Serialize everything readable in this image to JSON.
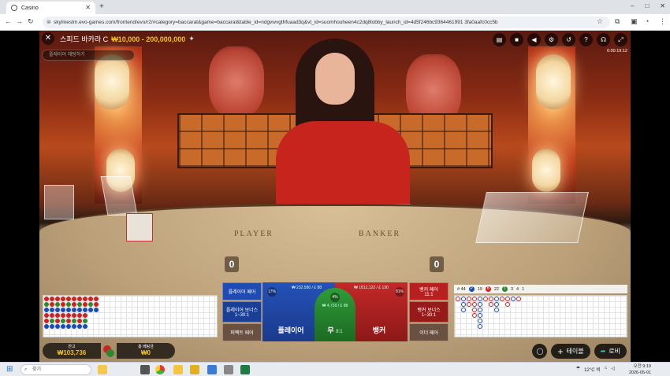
{
  "browser": {
    "tab_title": "Casino",
    "new_tab": "+",
    "url": "skylinestm.evo-games.com/frontend/evo/r2/#category=baccarat&game=baccarat&table_id=ndgvwvgthfuaad3q&vt_id=suomhouheen4c2dq8lobby_launch_id=4d5f246bc9364461991 3fa0aafc0cc5b",
    "window_controls": [
      "–",
      "□",
      "✕"
    ]
  },
  "game": {
    "title": "스피드 바카라 C",
    "limits": "₩10,000 - 200,000,000",
    "chat_placeholder": "플레이어 채팅하기",
    "timer": "0:00:19:12",
    "player_word": "PLAYER",
    "banker_word": "BANKER",
    "player_score": "0",
    "banker_score": "0",
    "colors": {
      "player": "#1a3a8c",
      "banker": "#a01c1c",
      "tie": "#237a2a",
      "gold": "#f3c21a"
    }
  },
  "bets": {
    "player_pair": "플레이어 페어",
    "player_bonus": "플레이어 보너스",
    "player_bonus_odds": "1~30:1",
    "perfect_pair": "퍼펙트 페어",
    "player_main": "플레이어",
    "player_pct": "17%",
    "player_info": "₩ 232,580 / £ 88",
    "tie_main": "무",
    "tie_odds": "8:1",
    "tie_pct": "4%",
    "tie_info": "₩ 4,720 / £ 88",
    "banker_main": "뱅커",
    "banker_pct": "81%",
    "banker_info": "₩ 1812,122 / £ 130",
    "banker_pair": "뱅커 페어",
    "banker_pair_odds": "11:1",
    "banker_bonus": "뱅커 보너스",
    "banker_bonus_odds": "1~30:1",
    "either_pair": "이더 페어"
  },
  "stats": {
    "total": "# 44",
    "player_label": "P",
    "player_count": "19",
    "banker_label": "B",
    "banker_count": "22",
    "tie_label": "T",
    "tie_count": "3",
    "pp_count": "4",
    "bp_count": "1"
  },
  "footer": {
    "balance_label": "잔고",
    "balance_value": "₩103,736",
    "total_bet_label": "총 베팅금",
    "total_bet_value": "₩0",
    "tables_btn": "테이블",
    "lobby_btn": "로비"
  },
  "taskbar": {
    "search_placeholder": "찾기",
    "weather": "12°C 비",
    "time": "오전 9:19",
    "date": "2026-05-01"
  },
  "icons": [
    "close-icon",
    "star-icon",
    "chat-icon",
    "video-icon",
    "sound-icon",
    "settings-icon",
    "history-icon",
    "help-icon",
    "support-icon",
    "fullscreen-icon"
  ]
}
